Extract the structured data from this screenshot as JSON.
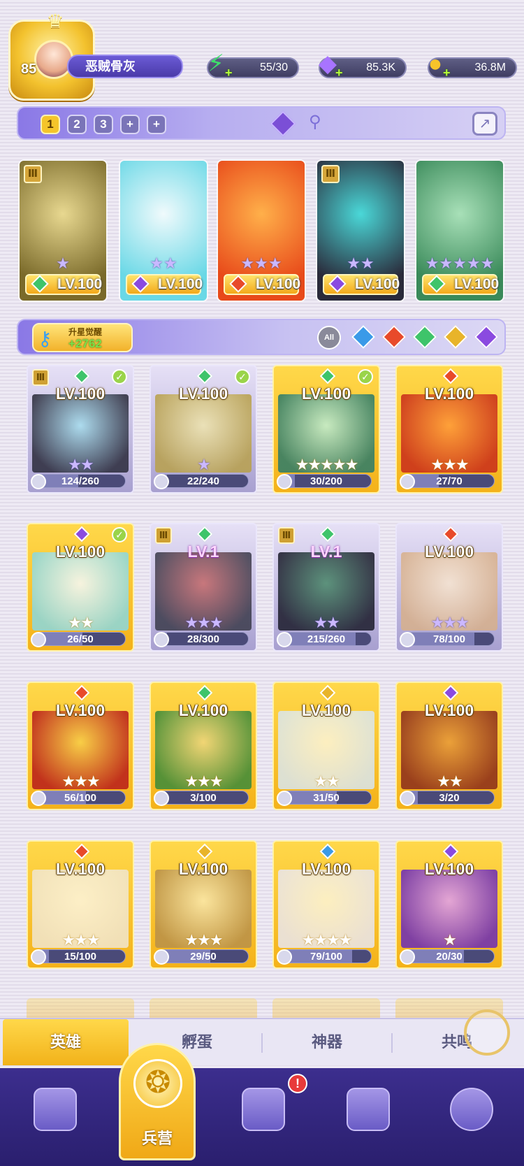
{
  "player": {
    "level": "85",
    "name": "恶贼骨灰"
  },
  "resources": {
    "energy": "55/30",
    "gems": "85.3K",
    "gold": "36.8M"
  },
  "team_tabs": [
    "1",
    "2",
    "3",
    "+",
    "+"
  ],
  "team_heroes": [
    {
      "level": "LV.100",
      "stars": "★",
      "element_color": "#3ec46a",
      "art": [
        "#7a6a2a",
        "#e8d890"
      ],
      "badge": true
    },
    {
      "level": "LV.100",
      "stars": "★★",
      "element_color": "#8a4ae0",
      "art": [
        "#6ad8e6",
        "#f0fafc"
      ],
      "badge": false
    },
    {
      "level": "LV.100",
      "stars": "★★★",
      "element_color": "#e84a2a",
      "art": [
        "#e84a1a",
        "#ffb04a"
      ],
      "badge": false
    },
    {
      "level": "LV.100",
      "stars": "★★",
      "element_color": "#8a4ae0",
      "art": [
        "#2a2a3a",
        "#4ad8d8"
      ],
      "badge": true
    },
    {
      "level": "LV.100",
      "stars": "★★★★★",
      "element_color": "#3ec46a",
      "art": [
        "#3a8a5a",
        "#a8e0b8"
      ],
      "badge": false
    }
  ],
  "awaken": {
    "label": "升星觉醒",
    "value": "+2762"
  },
  "filter": {
    "all_label": "All",
    "gems": [
      "#3a9ae8",
      "#e84a2a",
      "#3ec46a",
      "#e8b42a",
      "#8a4ae0"
    ]
  },
  "heroes": [
    {
      "level": "LV.100",
      "stars": "★★",
      "progress": "124/260",
      "element_color": "#3ec46a",
      "check": true,
      "badge": true,
      "style": "grey",
      "low": false,
      "art": [
        "#2a2a3a",
        "#a8e0f0"
      ]
    },
    {
      "level": "LV.100",
      "stars": "★",
      "progress": "22/240",
      "element_color": "#3ec46a",
      "check": true,
      "badge": false,
      "style": "grey",
      "low": false,
      "art": [
        "#b8a04a",
        "#f0e6b0"
      ]
    },
    {
      "level": "LV.100",
      "stars": "★★★★★",
      "progress": "30/200",
      "element_color": "#3ec46a",
      "check": true,
      "badge": false,
      "style": "gold",
      "low": false,
      "art": [
        "#2a7a6a",
        "#bff0d8"
      ]
    },
    {
      "level": "LV.100",
      "stars": "★★★",
      "progress": "27/70",
      "element_color": "#e84a2a",
      "check": false,
      "badge": false,
      "style": "gold",
      "low": false,
      "art": [
        "#c82a1a",
        "#ff9a3a"
      ]
    },
    {
      "level": "LV.100",
      "stars": "★★",
      "progress": "26/50",
      "element_color": "#8a4ae0",
      "check": true,
      "badge": false,
      "style": "gold",
      "low": false,
      "art": [
        "#8ad8e0",
        "#f6fbfc"
      ]
    },
    {
      "level": "LV.1",
      "stars": "★★★",
      "progress": "28/300",
      "element_color": "#3ec46a",
      "check": false,
      "badge": true,
      "style": "grey",
      "low": true,
      "art": [
        "#3a3a4a",
        "#c86a6a"
      ]
    },
    {
      "level": "LV.1",
      "stars": "★★",
      "progress": "215/260",
      "element_color": "#3ec46a",
      "check": false,
      "badge": true,
      "style": "grey",
      "low": true,
      "art": [
        "#1a1a2a",
        "#4a8a6a"
      ]
    },
    {
      "level": "LV.100",
      "stars": "★★★",
      "progress": "78/100",
      "element_color": "#e84a2a",
      "check": false,
      "badge": false,
      "style": "grey",
      "low": false,
      "art": [
        "#d8b08a",
        "#f8e6d0"
      ]
    },
    {
      "level": "LV.100",
      "stars": "★★★",
      "progress": "56/100",
      "element_color": "#e84a2a",
      "check": false,
      "badge": false,
      "style": "gold",
      "low": false,
      "art": [
        "#b81a1a",
        "#f8d04a"
      ]
    },
    {
      "level": "LV.100",
      "stars": "★★★",
      "progress": "3/100",
      "element_color": "#3ec46a",
      "check": false,
      "badge": false,
      "style": "gold",
      "low": false,
      "art": [
        "#3a8a3a",
        "#f0d880"
      ]
    },
    {
      "level": "LV.100",
      "stars": "★★",
      "progress": "31/50",
      "element_color": "#e8b42a",
      "check": false,
      "badge": false,
      "style": "gold",
      "low": false,
      "art": [
        "#d8e6f0",
        "#fdf6d8"
      ]
    },
    {
      "level": "LV.100",
      "stars": "★★",
      "progress": "3/20",
      "element_color": "#8a4ae0",
      "check": false,
      "badge": false,
      "style": "gold",
      "low": false,
      "art": [
        "#8a2a1a",
        "#e89a3a"
      ]
    },
    {
      "level": "LV.100",
      "stars": "★★★",
      "progress": "15/100",
      "element_color": "#e84a2a",
      "check": false,
      "badge": false,
      "style": "gold",
      "low": false,
      "art": [
        "#f0e6d0",
        "#fdf6e0"
      ]
    },
    {
      "level": "LV.100",
      "stars": "★★★",
      "progress": "29/50",
      "element_color": "#e8b42a",
      "check": false,
      "badge": false,
      "style": "gold",
      "low": false,
      "art": [
        "#b8904a",
        "#fbeab0"
      ]
    },
    {
      "level": "LV.100",
      "stars": "★★★★",
      "progress": "79/100",
      "element_color": "#3a9ae8",
      "check": false,
      "badge": false,
      "style": "gold",
      "low": false,
      "art": [
        "#e8e6f0",
        "#fdf6d8"
      ]
    },
    {
      "level": "LV.100",
      "stars": "★",
      "progress": "20/30",
      "element_color": "#8a4ae0",
      "check": false,
      "badge": false,
      "style": "gold",
      "low": false,
      "art": [
        "#6a2ab8",
        "#e0a0f0"
      ]
    }
  ],
  "sub_tabs": [
    "英雄",
    "孵蛋",
    "神器",
    "共鸣"
  ],
  "bottom_nav": {
    "center_label": "兵营",
    "notification": "!"
  }
}
